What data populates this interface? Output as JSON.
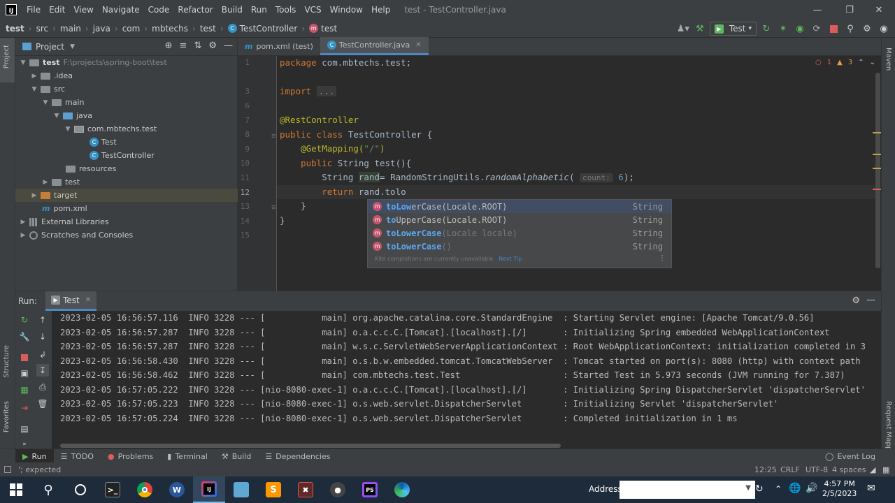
{
  "menu": {
    "items": [
      "File",
      "Edit",
      "View",
      "Navigate",
      "Code",
      "Refactor",
      "Build",
      "Run",
      "Tools",
      "VCS",
      "Window",
      "Help"
    ],
    "window_title": "test - TestController.java"
  },
  "breadcrumb": [
    "test",
    "src",
    "main",
    "java",
    "com",
    "mbtechs",
    "test",
    "TestController",
    "test"
  ],
  "toolbar": {
    "run_config": "Test"
  },
  "project": {
    "header": "Project",
    "tree": [
      {
        "label": "test",
        "extra": "F:\\projects\\spring-boot\\test"
      },
      {
        "label": ".idea"
      },
      {
        "label": "src"
      },
      {
        "label": "main"
      },
      {
        "label": "java"
      },
      {
        "label": "com.mbtechs.test"
      },
      {
        "label": "Test"
      },
      {
        "label": "TestController"
      },
      {
        "label": "resources"
      },
      {
        "label": "test"
      },
      {
        "label": "target"
      },
      {
        "label": "pom.xml"
      },
      {
        "label": "External Libraries"
      },
      {
        "label": "Scratches and Consoles"
      }
    ]
  },
  "editor": {
    "tabs": [
      "pom.xml (test)",
      "TestController.java"
    ],
    "line_numbers": [
      "1",
      "3",
      "6",
      "7",
      "8",
      "9",
      "10",
      "11",
      "12",
      "13",
      "14",
      "15"
    ],
    "code": {
      "l1_kw": "package ",
      "l1_rest": "com.mbtechs.test;",
      "l3_kw": "import ",
      "l3_fold": "...",
      "l7": "@RestController",
      "l8_kw": "public class ",
      "l8_rest": "TestController {",
      "l9_ann": "@GetMapping(",
      "l9_str": "\"/\"",
      "l9_end": ")",
      "l10_kw": "public ",
      "l10_type": "String ",
      "l10_name": "test",
      "l10_end": "(){",
      "l11_type": "String ",
      "l11_var": "rand",
      "l11_mid": "= RandomStringUtils.",
      "l11_call": "randomAlphabetic",
      "l11_paren": "( ",
      "l11_hint": "count:",
      "l11_num": "6",
      "l11_end": ");",
      "l12_kw": "return ",
      "l12_rest": "rand.tolo",
      "l13": "}",
      "l14": "}"
    },
    "inspection": {
      "errors": "1",
      "warnings": "3"
    }
  },
  "completion": {
    "items": [
      {
        "match1": "to",
        "match2": "Lo",
        "rest1": "w",
        "rest2": "erCase(Locale.ROOT)",
        "dim": "",
        "type": "String"
      },
      {
        "match1": "to",
        "match2": "",
        "rest1": "UpperCase(",
        "rest2": "Locale.ROOT)",
        "dim": "",
        "type": "String"
      },
      {
        "match1": "to",
        "match2": "Lo",
        "rest1": "w",
        "rest2": "erCase",
        "dim": "(Locale locale)",
        "type": "String"
      },
      {
        "match1": "to",
        "match2": "Lo",
        "rest1": "w",
        "rest2": "erCase",
        "dim": "()",
        "type": "String"
      }
    ],
    "footer": "Kite completions are currently unavailable",
    "footer_link": "Next Tip"
  },
  "run": {
    "label": "Run:",
    "tab": "Test",
    "log": [
      "2023-02-05 16:56:57.116  INFO 3228 --- [           main] org.apache.catalina.core.StandardEngine  : Starting Servlet engine: [Apache Tomcat/9.0.56]",
      "2023-02-05 16:56:57.287  INFO 3228 --- [           main] o.a.c.c.C.[Tomcat].[localhost].[/]       : Initializing Spring embedded WebApplicationContext",
      "2023-02-05 16:56:57.287  INFO 3228 --- [           main] w.s.c.ServletWebServerApplicationContext : Root WebApplicationContext: initialization completed in 3",
      "2023-02-05 16:56:58.430  INFO 3228 --- [           main] o.s.b.w.embedded.tomcat.TomcatWebServer  : Tomcat started on port(s): 8080 (http) with context path",
      "2023-02-05 16:56:58.462  INFO 3228 --- [           main] com.mbtechs.test.Test                    : Started Test in 5.973 seconds (JVM running for 7.387)",
      "2023-02-05 16:57:05.222  INFO 3228 --- [nio-8080-exec-1] o.a.c.c.C.[Tomcat].[localhost].[/]       : Initializing Spring DispatcherServlet 'dispatcherServlet'",
      "2023-02-05 16:57:05.223  INFO 3228 --- [nio-8080-exec-1] o.s.web.servlet.DispatcherServlet        : Initializing Servlet 'dispatcherServlet'",
      "2023-02-05 16:57:05.224  INFO 3228 --- [nio-8080-exec-1] o.s.web.servlet.DispatcherServlet        : Completed initialization in 1 ms"
    ]
  },
  "bottom_tabs": [
    "Run",
    "TODO",
    "Problems",
    "Terminal",
    "Build",
    "Dependencies"
  ],
  "event_log": "Event Log",
  "side_tabs": {
    "left": [
      "Project",
      "Structure",
      "Favorites"
    ],
    "right": [
      "Maven",
      "Request Mapping"
    ]
  },
  "status": {
    "message": "'; expected",
    "position": "12:25",
    "line_sep": "CRLF",
    "encoding": "UTF-8",
    "indent": "4 spaces"
  },
  "taskbar": {
    "address_label": "Address",
    "time": "4:57 PM",
    "date": "2/5/2023"
  },
  "colors": {
    "accent": "#4a88c7",
    "bg": "#2b2b2b",
    "panel": "#3c3f41"
  }
}
